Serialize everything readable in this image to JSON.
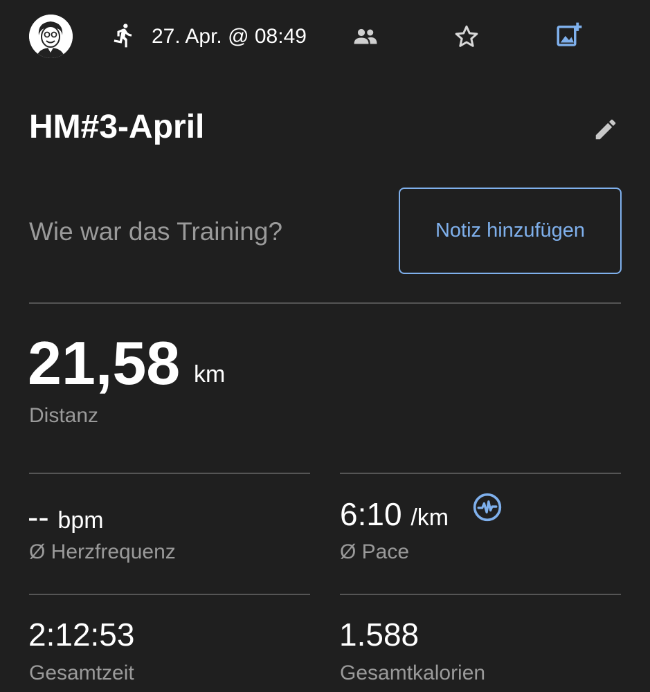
{
  "header": {
    "date_time": "27. Apr. @ 08:49",
    "icons": [
      "avatar",
      "running-icon",
      "group-icon",
      "star-icon",
      "add-photo-icon"
    ]
  },
  "activity": {
    "title": "HM#3-April",
    "note_prompt": "Wie war das Training?",
    "note_button": "Notiz hinzufügen"
  },
  "distance": {
    "value": "21,58",
    "unit": "km",
    "label": "Distanz"
  },
  "stats": {
    "heart_rate": {
      "value": "--",
      "unit": "bpm",
      "label": "Ø Herzfrequenz"
    },
    "pace": {
      "value": "6:10",
      "unit": "/km",
      "label": "Ø Pace"
    },
    "total_time": {
      "value": "2:12:53",
      "label": "Gesamtzeit"
    },
    "calories": {
      "value": "1.588",
      "label": "Gesamtkalorien"
    }
  },
  "colors": {
    "background": "#1f1f1f",
    "accent": "#7fb0ec",
    "secondary_text": "#9a9a9a",
    "divider": "#555555"
  }
}
